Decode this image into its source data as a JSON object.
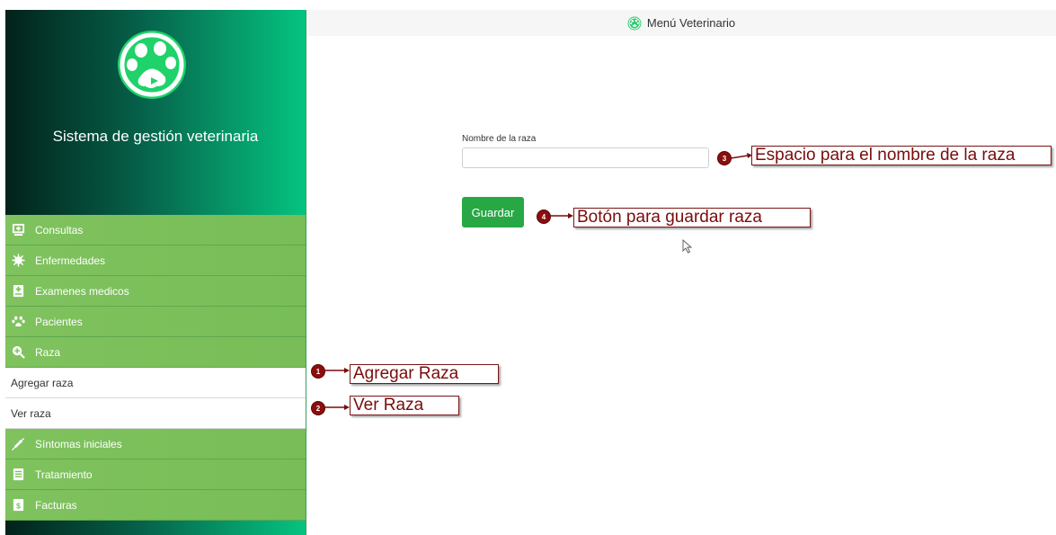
{
  "header": {
    "title": "Menú Veterinario",
    "icon": "paw-logo-icon"
  },
  "sidebar": {
    "app_title": "Sistema de gestión veterinaria",
    "logo": "paw-logo-icon",
    "items": [
      {
        "label": "Consultas",
        "icon": "monitor-icon"
      },
      {
        "label": "Enfermedades",
        "icon": "virus-icon"
      },
      {
        "label": "Examenes medicos",
        "icon": "medical-file-icon"
      },
      {
        "label": "Pacientes",
        "icon": "paw-icon"
      },
      {
        "label": "Raza",
        "icon": "search-plus-icon"
      }
    ],
    "subitems": [
      {
        "label": "Agregar raza"
      },
      {
        "label": "Ver raza"
      }
    ],
    "items_after": [
      {
        "label": "Síntomas iniciales",
        "icon": "syringe-icon"
      },
      {
        "label": "Tratamiento",
        "icon": "document-icon"
      },
      {
        "label": "Facturas",
        "icon": "invoice-icon"
      }
    ]
  },
  "form": {
    "field_label": "Nombre de la raza",
    "field_value": "",
    "save_label": "Guardar"
  },
  "annotations": [
    {
      "number": "1",
      "text": "Agregar Raza"
    },
    {
      "number": "2",
      "text": "Ver Raza"
    },
    {
      "number": "3",
      "text": "Espacio para el nombre de la raza"
    },
    {
      "number": "4",
      "text": "Botón para guardar raza"
    }
  ],
  "colors": {
    "sidebar_menu": "#7fc25e",
    "accent_green": "#28a745",
    "annotation": "#8b0e0e"
  }
}
